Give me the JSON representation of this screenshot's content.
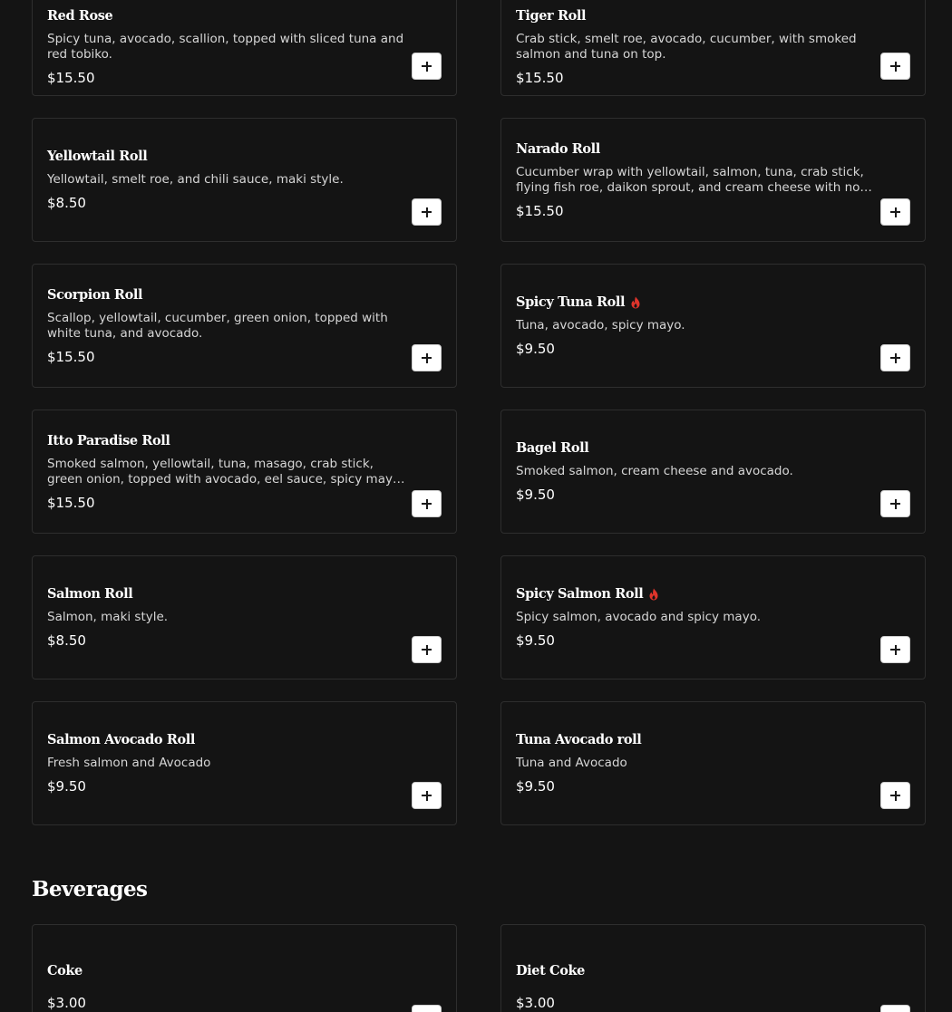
{
  "colors": {
    "background": "#141414",
    "card_border": "#2e2e2e",
    "spicy_icon": "#e0342b"
  },
  "menu": {
    "items": [
      {
        "name": "Red Rose",
        "desc": "Spicy tuna, avocado, scallion, topped with sliced tuna and red tobiko.",
        "price": "$15.50",
        "spicy": false,
        "add_icon": "plus-icon"
      },
      {
        "name": "Tiger Roll",
        "desc": "Crab stick, smelt roe, avocado, cucumber, with smoked salmon and tuna on top.",
        "price": "$15.50",
        "spicy": false,
        "add_icon": "plus-icon"
      },
      {
        "name": "Yellowtail Roll",
        "desc": "Yellowtail, smelt roe, and chili sauce, maki style.",
        "price": "$8.50",
        "spicy": false,
        "add_icon": "plus-icon"
      },
      {
        "name": "Narado Roll",
        "desc": "Cucumber wrap with yellowtail, salmon, tuna, crab stick, flying fish roe, daikon sprout, and cream cheese with no rice.",
        "price": "$15.50",
        "spicy": false,
        "add_icon": "plus-icon"
      },
      {
        "name": "Scorpion Roll",
        "desc": "Scallop, yellowtail, cucumber, green onion, topped with white tuna, and avocado.",
        "price": "$15.50",
        "spicy": false,
        "add_icon": "plus-icon"
      },
      {
        "name": "Spicy Tuna Roll",
        "desc": "Tuna, avocado, spicy mayo.",
        "price": "$9.50",
        "spicy": true,
        "add_icon": "plus-icon"
      },
      {
        "name": "Itto Paradise Roll",
        "desc": "Smoked salmon, yellowtail, tuna, masago, crab stick, green onion, topped with avocado, eel sauce, spicy mayo and chili...",
        "price": "$15.50",
        "spicy": false,
        "add_icon": "plus-icon"
      },
      {
        "name": "Bagel Roll",
        "desc": "Smoked salmon, cream cheese and avocado.",
        "price": "$9.50",
        "spicy": false,
        "add_icon": "plus-icon"
      },
      {
        "name": "Salmon Roll",
        "desc": "Salmon, maki style.",
        "price": "$8.50",
        "spicy": false,
        "add_icon": "plus-icon"
      },
      {
        "name": "Spicy Salmon Roll",
        "desc": "Spicy salmon, avocado and spicy mayo.",
        "price": "$9.50",
        "spicy": true,
        "add_icon": "plus-icon"
      },
      {
        "name": "Salmon Avocado Roll",
        "desc": "Fresh salmon and Avocado",
        "price": "$9.50",
        "spicy": false,
        "add_icon": "plus-icon"
      },
      {
        "name": "Tuna Avocado roll",
        "desc": "Tuna and Avocado",
        "price": "$9.50",
        "spicy": false,
        "add_icon": "plus-icon"
      }
    ]
  },
  "beverages": {
    "title": "Beverages",
    "items": [
      {
        "name": "Coke",
        "price": "$3.00",
        "add_icon": "plus-icon"
      },
      {
        "name": "Diet Coke",
        "price": "$3.00",
        "add_icon": "plus-icon"
      }
    ]
  }
}
